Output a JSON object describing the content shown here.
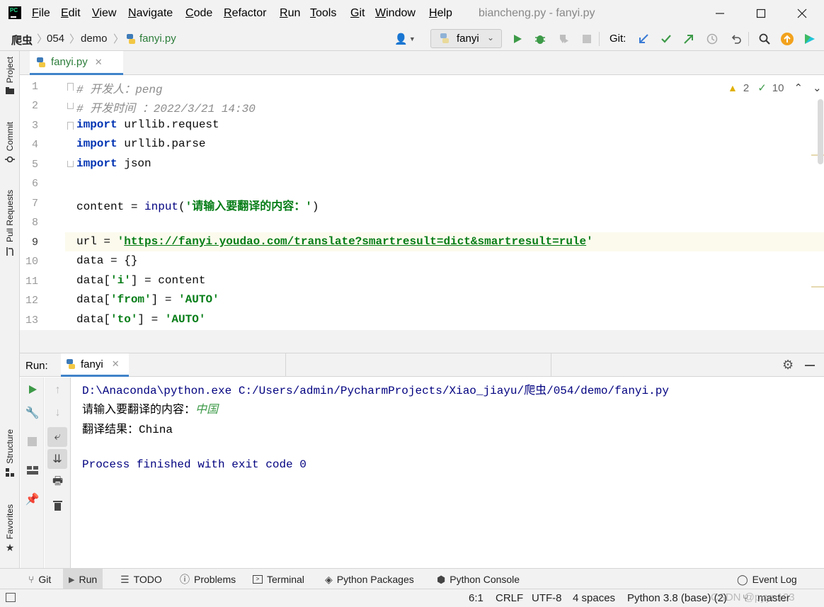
{
  "title_bar": {
    "menu": [
      "File",
      "Edit",
      "View",
      "Navigate",
      "Code",
      "Refactor",
      "Run",
      "Tools",
      "Git",
      "Window",
      "Help"
    ],
    "window_title": "biancheng.py - fanyi.py",
    "logo_text": "PC"
  },
  "breadcrumb": [
    "爬虫",
    "054",
    "demo",
    "fanyi.py"
  ],
  "toolbar": {
    "run_config": "fanyi",
    "git_label": "Git:"
  },
  "left_strip": {
    "tabs": [
      "Project",
      "Commit",
      "Pull Requests",
      "Structure",
      "Favorites"
    ]
  },
  "editor": {
    "tab_label": "fanyi.py",
    "warnings_count": "2",
    "checks_count": "10",
    "line_numbers": [
      "1",
      "2",
      "3",
      "4",
      "5",
      "6",
      "7",
      "8",
      "9",
      "10",
      "11",
      "12",
      "13"
    ],
    "lines": {
      "l1_comment": "# 开发人：peng",
      "l2_comment": "# 开发时间 ：2022/3/21 14:30",
      "kw_import": "import",
      "l3_mod": " urllib.request",
      "l4_mod": " urllib.parse",
      "l5_mod": " json",
      "l7_a": "content = ",
      "l7_fn": "input",
      "l7_b": "(",
      "l7_str": "'请输入要翻译的内容：'",
      "l7_c": ")",
      "l9_a": "url = ",
      "l9_q1": "'",
      "l9_url": "https://fanyi.youdao.com/translate?smartresult=dict&smartresult=rule",
      "l9_q2": "'",
      "l10": "data = {}",
      "l11_a": "data[",
      "l11_str": "'i'",
      "l11_b": "] = content",
      "l12_a": "data[",
      "l12_str": "'from'",
      "l12_b": "] = ",
      "l12_val": "'AUTO'",
      "l13_a": "data[",
      "l13_str": "'to'",
      "l13_b": "] = ",
      "l13_val": "'AUTO'"
    }
  },
  "run_panel": {
    "label": "Run:",
    "tab_label": "fanyi",
    "console": {
      "cmd": "D:\\Anaconda\\python.exe C:/Users/admin/PycharmProjects/Xiao_jiayu/爬虫/054/demo/fanyi.py",
      "prompt": "请输入要翻译的内容：",
      "user_input": "中国",
      "result": "翻译结果：China",
      "exit": "Process finished with exit code 0"
    }
  },
  "bottom_tools": [
    "Git",
    "Run",
    "TODO",
    "Problems",
    "Terminal",
    "Python Packages",
    "Python Console",
    "Event Log"
  ],
  "status_bar": {
    "position": "6:1",
    "line_sep": "CRLF",
    "encoding": "UTF-8",
    "indent": "4 spaces",
    "interpreter": "Python 3.8 (base) (2)",
    "branch": "master",
    "watermark": "CSDN @pyyn123"
  },
  "colors": {
    "keyword": "#0033b3",
    "string": "#067d17",
    "comment": "#8c8c8c",
    "console_blue": "#000080",
    "accent_tab": "#4083c9",
    "run_green": "#3d9a48"
  }
}
